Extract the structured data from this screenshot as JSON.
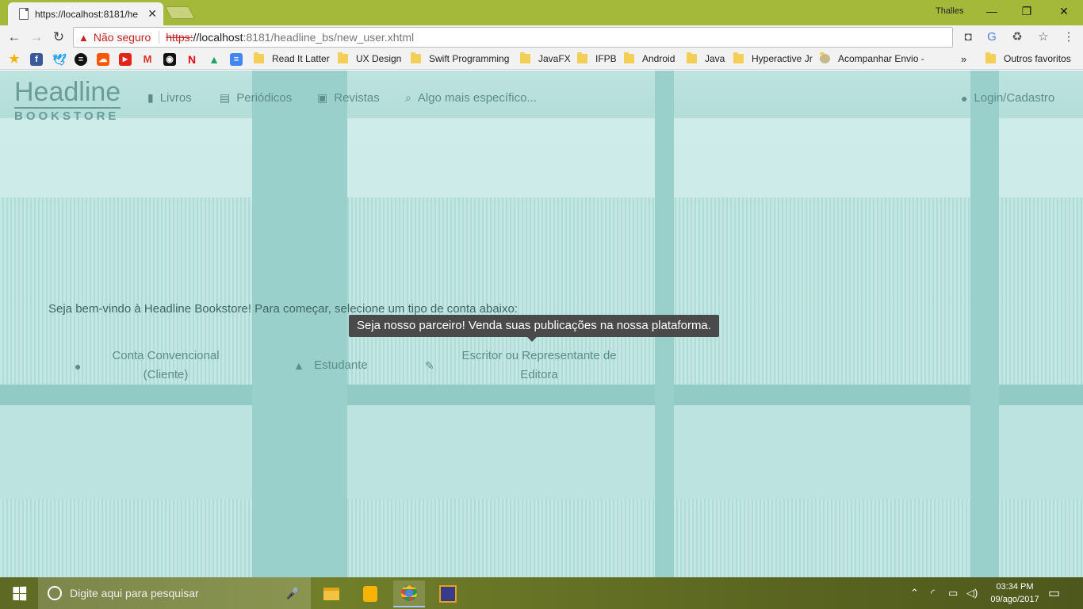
{
  "browser": {
    "tab_title": "https://localhost:8181/he",
    "window_user": "Thalles",
    "security_label": "Não seguro",
    "url_proto": "https:",
    "url_host": "//localhost",
    "url_rest": ":8181/headline_bs/new_user.xhtml",
    "bookmarks": [
      {
        "label": "Read It Latter"
      },
      {
        "label": "UX Design"
      },
      {
        "label": "Swift Programming"
      },
      {
        "label": "JavaFX"
      },
      {
        "label": "IFPB"
      },
      {
        "label": "Android"
      },
      {
        "label": "Java"
      },
      {
        "label": "Hyperactive Jr"
      },
      {
        "label": "Acompanhar Envio -"
      }
    ],
    "bookmarks_overflow": "»",
    "other_bookmarks": "Outros favoritos"
  },
  "site": {
    "logo_top": "Headline",
    "logo_bottom": "BOOKSTORE",
    "nav": [
      {
        "label": "Livros",
        "icon": "book-icon"
      },
      {
        "label": "Periódicos",
        "icon": "newspaper-icon"
      },
      {
        "label": "Revistas",
        "icon": "image-icon"
      },
      {
        "label": "Algo mais específico...",
        "icon": "search-icon"
      }
    ],
    "login_label": "Login/Cadastro",
    "welcome": "Seja bem-vindo à Headline Bookstore! Para começar, selecione um tipo de conta abaixo:",
    "accounts": {
      "conventional_line1": "Conta Convencional",
      "conventional_line2": "(Cliente)",
      "student": "Estudante",
      "writer_line1": "Escritor ou Representante de",
      "writer_line2": "Editora"
    },
    "tooltip": "Seja nosso parceiro! Venda suas publicações na nossa plataforma."
  },
  "taskbar": {
    "search_placeholder": "Digite aqui para pesquisar",
    "time": "03:34 PM",
    "date": "09/ago/2017"
  }
}
